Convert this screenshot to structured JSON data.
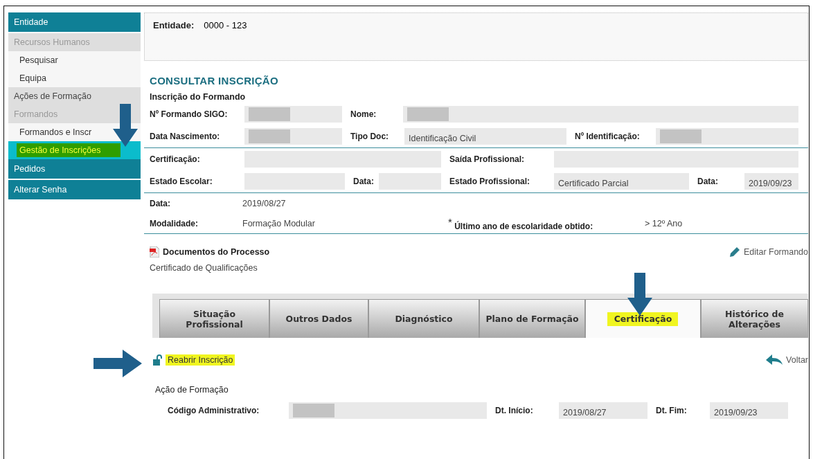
{
  "sidebar": {
    "items": [
      {
        "label": "Entidade",
        "kind": "section",
        "selected": false,
        "highlighted": false
      },
      {
        "label": "Recursos Humanos",
        "kind": "group",
        "selected": false,
        "highlighted": false
      },
      {
        "label": "Pesquisar",
        "kind": "item",
        "selected": false,
        "highlighted": false
      },
      {
        "label": "Equipa",
        "kind": "item",
        "selected": false,
        "highlighted": false
      },
      {
        "label": "Ações de Formação",
        "kind": "link-group",
        "selected": false,
        "highlighted": false
      },
      {
        "label": "Formandos",
        "kind": "group",
        "selected": false,
        "highlighted": false
      },
      {
        "label": "Formandos e Inscr",
        "kind": "item",
        "selected": false,
        "highlighted": false
      },
      {
        "label": "Gestão de Inscrições",
        "kind": "item",
        "selected": true,
        "highlighted": true
      },
      {
        "label": "Pedidos",
        "kind": "section",
        "selected": false,
        "highlighted": false
      },
      {
        "label": "Alterar Senha",
        "kind": "section",
        "selected": false,
        "highlighted": false
      }
    ]
  },
  "entity": {
    "label": "Entidade:",
    "value": "0000 - 123"
  },
  "page_title": "CONSULTAR INSCRIÇÃO",
  "section_title": "Inscrição do Formando",
  "form_groups": [
    [
      [
        {
          "kind": "label",
          "text": "Nº Formando SIGO:"
        },
        {
          "kind": "field",
          "redacted": true
        },
        {
          "kind": "label",
          "text": "Nome:"
        },
        {
          "kind": "field",
          "redacted": true
        }
      ],
      [
        {
          "kind": "label",
          "text": "Data Nascimento:"
        },
        {
          "kind": "field",
          "redacted": true
        },
        {
          "kind": "label",
          "text": "Tipo Doc:"
        },
        {
          "kind": "field",
          "value": "Identificação Civil",
          "redacted": false
        },
        {
          "kind": "label",
          "text": "Nº Identificação:"
        },
        {
          "kind": "field",
          "redacted": true
        }
      ]
    ],
    [
      [
        {
          "kind": "label",
          "text": "Certificação:"
        },
        {
          "kind": "field",
          "redacted": false
        },
        {
          "kind": "label",
          "text": "Saída Profissional:"
        },
        {
          "kind": "field",
          "redacted": false
        }
      ],
      [
        {
          "kind": "label",
          "text": "Estado Escolar:"
        },
        {
          "kind": "field",
          "redacted": false
        },
        {
          "kind": "label",
          "text": "Data:"
        },
        {
          "kind": "field",
          "redacted": false
        },
        {
          "kind": "label",
          "text": "Estado Profissional:"
        },
        {
          "kind": "field",
          "value": "Certificado Parcial",
          "redacted": false
        },
        {
          "kind": "label",
          "text": "Data:"
        },
        {
          "kind": "field",
          "value": "2019/09/23",
          "redacted": false
        }
      ]
    ],
    [
      [
        {
          "kind": "label",
          "text": "Data:"
        },
        {
          "kind": "text",
          "text": "2019/08/27"
        }
      ],
      [
        {
          "kind": "label",
          "text": "Modalidade:"
        },
        {
          "kind": "text",
          "text": "Formação Modular"
        },
        {
          "kind": "label",
          "text": "$^{*}$ Último ano de escolaridade obtido:"
        },
        {
          "kind": "text",
          "text": "> 12º Ano"
        }
      ]
    ]
  ],
  "documents_link": "Documentos do Processo",
  "edit_link": "Editar Formando",
  "certificate_text": "Certificado de Qualificações",
  "tabs": [
    {
      "label": "Situação Profissional",
      "selected": false,
      "highlighted": false
    },
    {
      "label": "Outros Dados",
      "selected": false,
      "highlighted": false
    },
    {
      "label": "Diagnóstico",
      "selected": false,
      "highlighted": false
    },
    {
      "label": "Plano de Formação",
      "selected": false,
      "highlighted": false
    },
    {
      "label": "Certificação",
      "selected": true,
      "highlighted": true
    },
    {
      "label": "Histórico de Alterações",
      "selected": false,
      "highlighted": false
    }
  ],
  "reopen_link": {
    "label": "Reabrir Inscrição",
    "highlighted": true
  },
  "back_link": "Voltar",
  "action": {
    "title": "Ação de Formação",
    "fields": [
      {
        "kind": "label",
        "text": "Código Administrativo:"
      },
      {
        "kind": "field",
        "redacted": true
      },
      {
        "kind": "label",
        "text": "Dt. Início:"
      },
      {
        "kind": "field",
        "value": "2019/08/27",
        "redacted": false
      },
      {
        "kind": "label",
        "text": "Dt. Fim:"
      },
      {
        "kind": "field",
        "value": "2019/09/23",
        "redacted": false
      }
    ]
  }
}
